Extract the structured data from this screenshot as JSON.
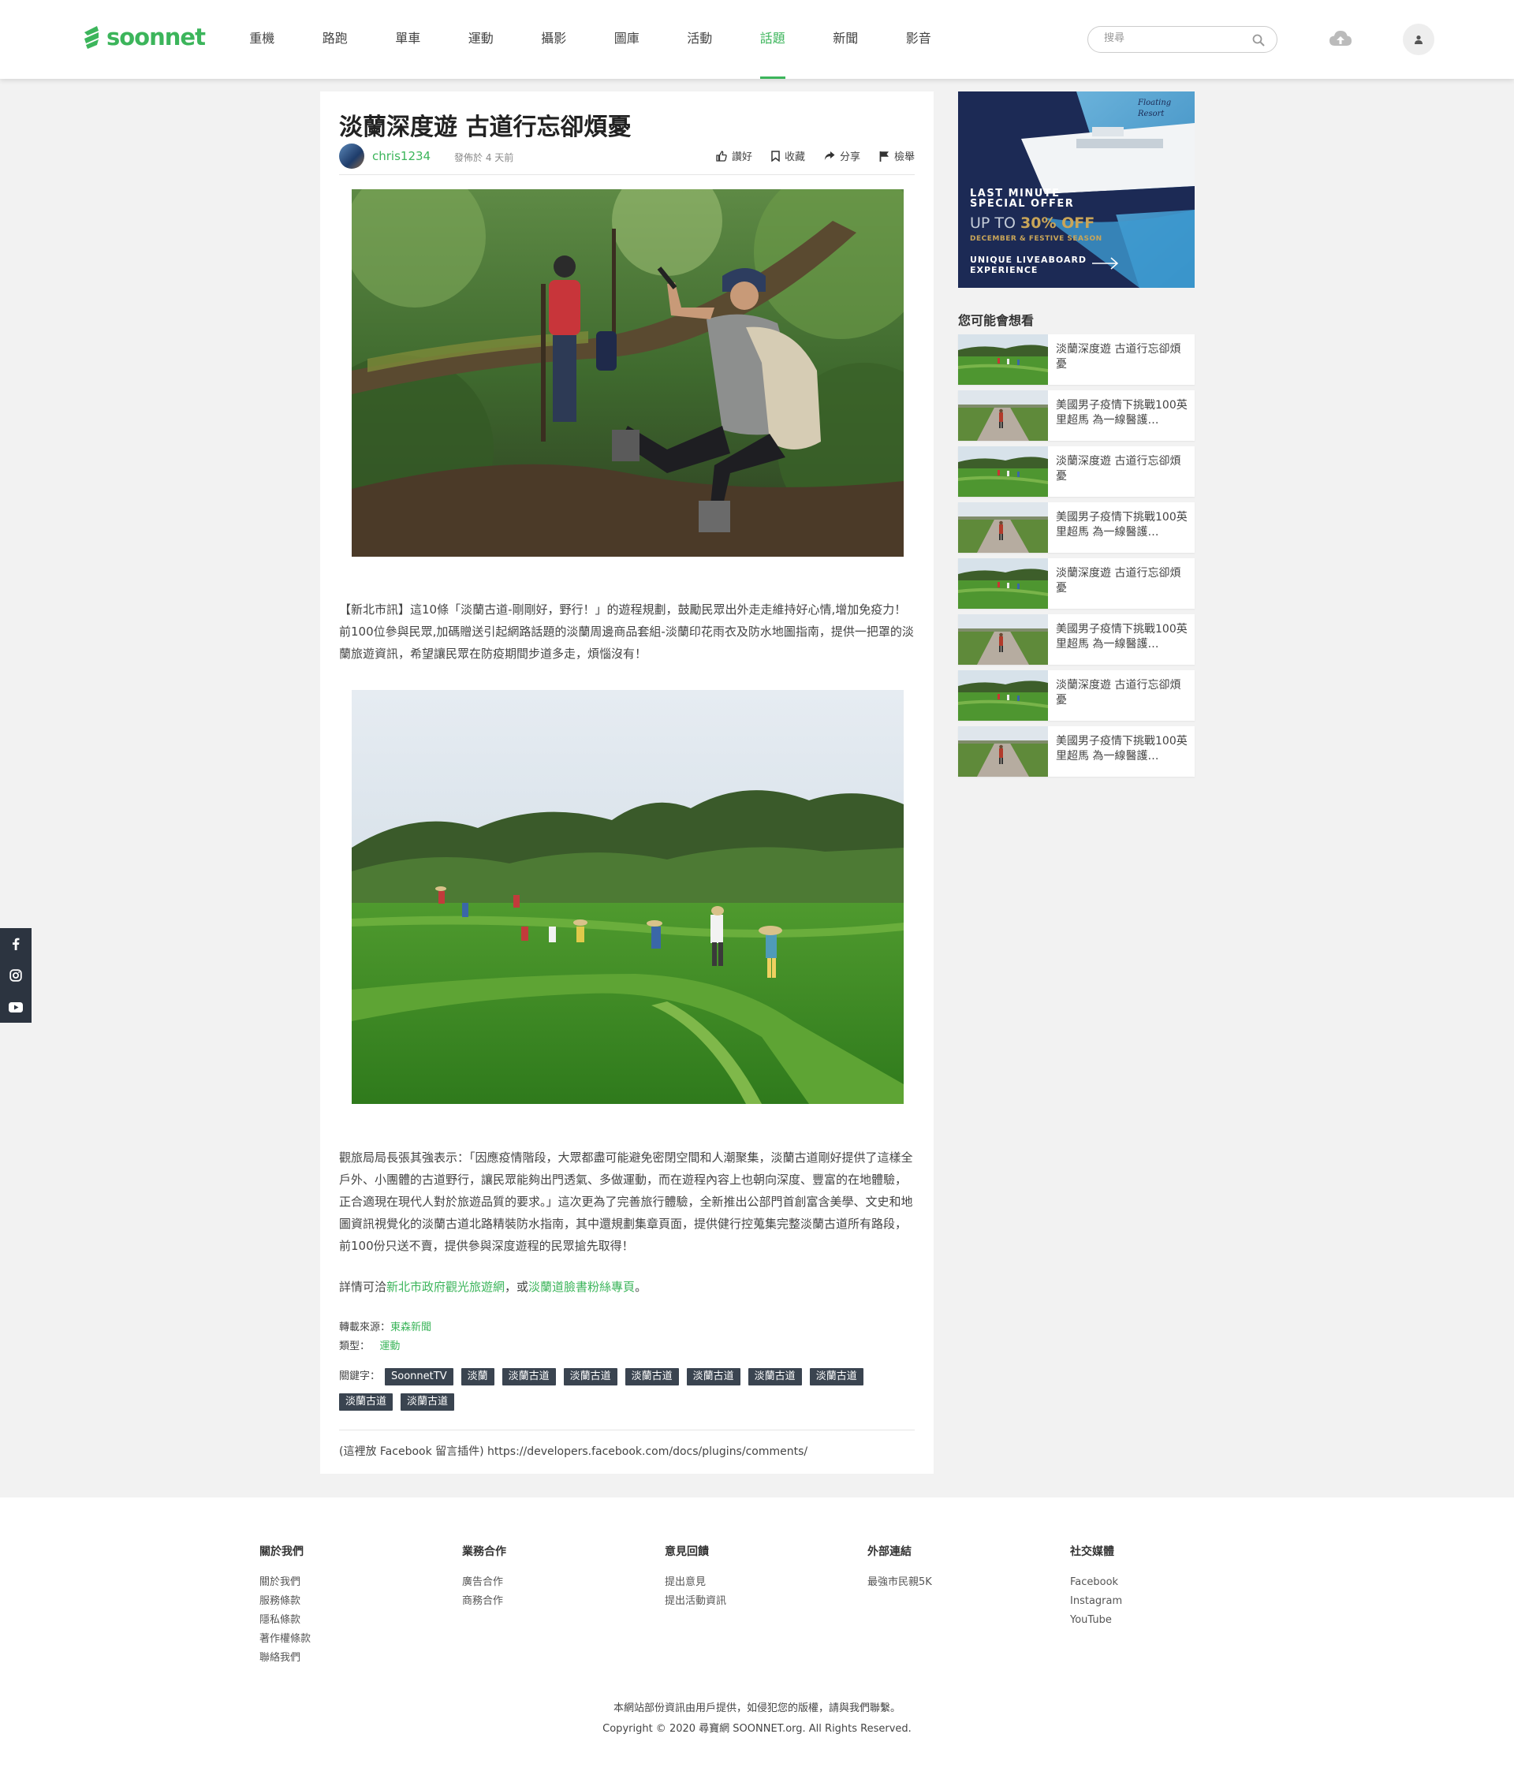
{
  "brand": {
    "name": "soonnet",
    "color": "#3cb55b"
  },
  "nav": [
    {
      "label": "重機"
    },
    {
      "label": "路跑"
    },
    {
      "label": "單車"
    },
    {
      "label": "運動"
    },
    {
      "label": "攝影"
    },
    {
      "label": "圖庫"
    },
    {
      "label": "活動"
    },
    {
      "label": "話題",
      "active": true
    },
    {
      "label": "新聞"
    },
    {
      "label": "影音"
    }
  ],
  "search": {
    "placeholder": "搜尋"
  },
  "article": {
    "title": "淡蘭深度遊 古道行忘卻煩憂",
    "author": "chris1234",
    "posted": "發佈於 4 天前",
    "actions": {
      "like": "讚好",
      "save": "收藏",
      "share": "分享",
      "report": "檢舉"
    },
    "p1": "【新北市訊】這10條「淡蘭古道-剛剛好，野行！」的遊程規劃，鼓勵民眾出外走走維持好心情,增加免疫力！前100位參與民眾,加碼贈送引起網路話題的淡蘭周邊商品套組-淡蘭印花雨衣及防水地圖指南，提供一把罩的淡蘭旅遊資訊，希望讓民眾在防疫期間步道多走，煩惱沒有！",
    "p2": "觀旅局局長張其強表示：「因應疫情階段，大眾都盡可能避免密閉空間和人潮聚集，淡蘭古道剛好提供了這樣全戶外、小團體的古道野行，讓民眾能夠出門透氣、多做運動，而在遊程內容上也朝向深度、豐富的在地體驗，正合適現在現代人對於旅遊品質的要求。」這次更為了完善旅行體驗，全新推出公部門首創富含美學、文史和地圖資訊視覺化的淡蘭古道北路精裝防水指南，其中還規劃集章頁面，提供健行控蒐集完整淡蘭古道所有路段，前100份只送不賣，提供參與深度遊程的民眾搶先取得！",
    "p3_prefix": "詳情可洽",
    "p3_link1": "新北市政府觀光旅遊網",
    "p3_mid": "，或",
    "p3_link2": "淡蘭道臉書粉絲專頁",
    "p3_suffix": "。",
    "source_label": "轉載來源：",
    "source_value": "東森新聞",
    "type_label": "類型：",
    "type_value": "運動",
    "tags_label": "關鍵字：",
    "tags": [
      "SoonnetTV",
      "淡蘭",
      "淡蘭古道",
      "淡蘭古道",
      "淡蘭古道",
      "淡蘭古道",
      "淡蘭古道",
      "淡蘭古道",
      "淡蘭古道",
      "淡蘭古道"
    ],
    "fb_comment": "(這裡放 Facebook 留言插件) https://developers.facebook.com/docs/plugins/comments/"
  },
  "ad": {
    "brand": "Floating Resort",
    "line1": "LAST MINUTE",
    "line2": "SPECIAL OFFER",
    "offer_prefix": "UP TO ",
    "offer_value": "30% OFF",
    "season": "DECEMBER & FESTIVE SEASON",
    "exp1": "UNIQUE LIVEABOARD",
    "exp2": "EXPERIENCE"
  },
  "related": {
    "title": "您可能會想看",
    "items": [
      {
        "text": "淡蘭深度遊 古道行忘卻煩憂",
        "kind": "field"
      },
      {
        "text": "美國男子疫情下挑戰100英里超馬 為一線醫護…",
        "kind": "road"
      },
      {
        "text": "淡蘭深度遊 古道行忘卻煩憂",
        "kind": "field"
      },
      {
        "text": "美國男子疫情下挑戰100英里超馬 為一線醫護…",
        "kind": "road"
      },
      {
        "text": "淡蘭深度遊 古道行忘卻煩憂",
        "kind": "field"
      },
      {
        "text": "美國男子疫情下挑戰100英里超馬 為一線醫護…",
        "kind": "road"
      },
      {
        "text": "淡蘭深度遊 古道行忘卻煩憂",
        "kind": "field"
      },
      {
        "text": "美國男子疫情下挑戰100英里超馬 為一線醫護…",
        "kind": "road"
      }
    ]
  },
  "footer": {
    "columns": [
      {
        "title": "關於我們",
        "links": [
          "關於我們",
          "服務條款",
          "隱私條款",
          "著作權條款",
          "聯絡我們"
        ]
      },
      {
        "title": "業務合作",
        "links": [
          "廣告合作",
          "商務合作"
        ]
      },
      {
        "title": "意見回饋",
        "links": [
          "提出意見",
          "提出活動資訊"
        ]
      },
      {
        "title": "外部連結",
        "links": [
          "最強市民親5K"
        ]
      },
      {
        "title": "社交媒體",
        "links": [
          "Facebook",
          "Instagram",
          "YouTube"
        ]
      }
    ],
    "notice": "本網站部份資訊由用戶提供，如侵犯您的版權，請與我們聯繫。",
    "copyright": "Copyright © 2020 尋寶網 SOONNET.org. All Rights Reserved."
  }
}
